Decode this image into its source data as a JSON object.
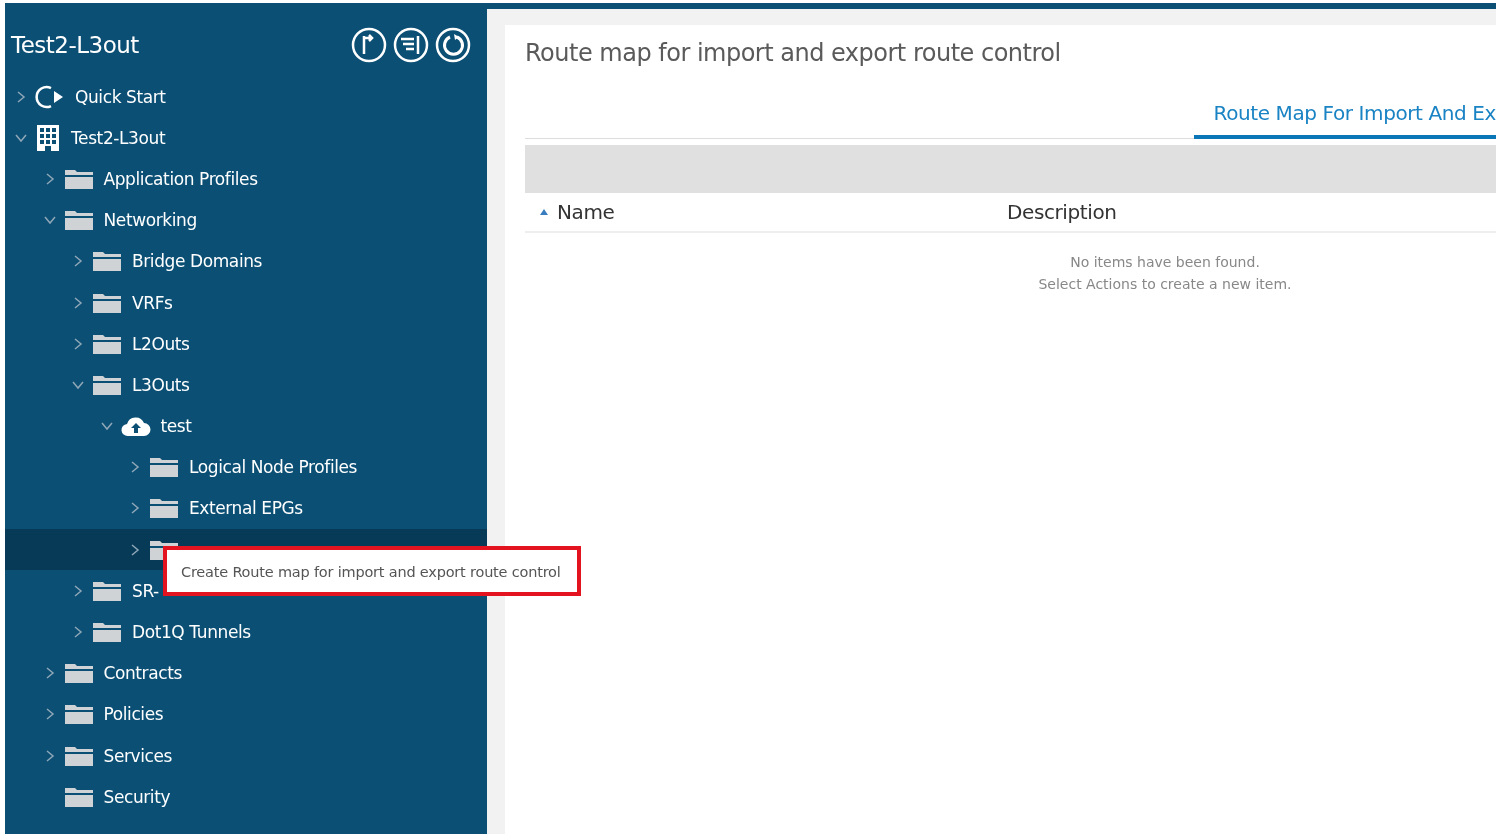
{
  "sidebar": {
    "title": "Test2-L3out",
    "tree": [
      {
        "label": "Quick Start",
        "kind": "quickstart",
        "expanded": false,
        "selected": false
      },
      {
        "label": "Test2-L3out",
        "kind": "tenant",
        "expanded": true,
        "selected": false,
        "children": [
          {
            "label": "Application Profiles",
            "kind": "folder",
            "expanded": false,
            "selected": false
          },
          {
            "label": "Networking",
            "kind": "folder",
            "expanded": true,
            "selected": false,
            "children": [
              {
                "label": "Bridge Domains",
                "kind": "folder",
                "expanded": false,
                "selected": false
              },
              {
                "label": "VRFs",
                "kind": "folder",
                "expanded": false,
                "selected": false
              },
              {
                "label": "L2Outs",
                "kind": "folder",
                "expanded": false,
                "selected": false
              },
              {
                "label": "L3Outs",
                "kind": "folder",
                "expanded": true,
                "selected": false,
                "children": [
                  {
                    "label": "test",
                    "kind": "cloud",
                    "expanded": true,
                    "selected": false,
                    "children": [
                      {
                        "label": "Logical Node Profiles",
                        "kind": "folder",
                        "expanded": false,
                        "selected": false
                      },
                      {
                        "label": "External EPGs",
                        "kind": "folder",
                        "expanded": false,
                        "selected": false
                      },
                      {
                        "kind": "folder",
                        "expanded": false,
                        "selected": true
                      }
                    ]
                  }
                ]
              },
              {
                "label": "SR-",
                "kind": "folder",
                "expanded": false,
                "selected": false
              },
              {
                "label": "Dot1Q Tunnels",
                "kind": "folder",
                "expanded": false,
                "selected": false
              }
            ]
          },
          {
            "label": "Contracts",
            "kind": "folder",
            "expanded": false,
            "selected": false
          },
          {
            "label": "Policies",
            "kind": "folder",
            "expanded": false,
            "selected": false
          },
          {
            "label": "Services",
            "kind": "folder",
            "expanded": false,
            "selected": false
          },
          {
            "label": "Security",
            "kind": "folder",
            "selected": false
          }
        ]
      }
    ]
  },
  "tooltip": {
    "text": "Create Route map for import and export route control"
  },
  "panel": {
    "title": "Route map for import and export route control",
    "tabs": [
      {
        "label": "Route Map For Import And Ex",
        "selected": true
      }
    ],
    "table": {
      "columns": [
        {
          "label": "Name",
          "sorted": true
        },
        {
          "label": "Description",
          "sorted": false
        }
      ],
      "empty_message": [
        "No items have been found.",
        "Select Actions to create a new item."
      ]
    }
  }
}
